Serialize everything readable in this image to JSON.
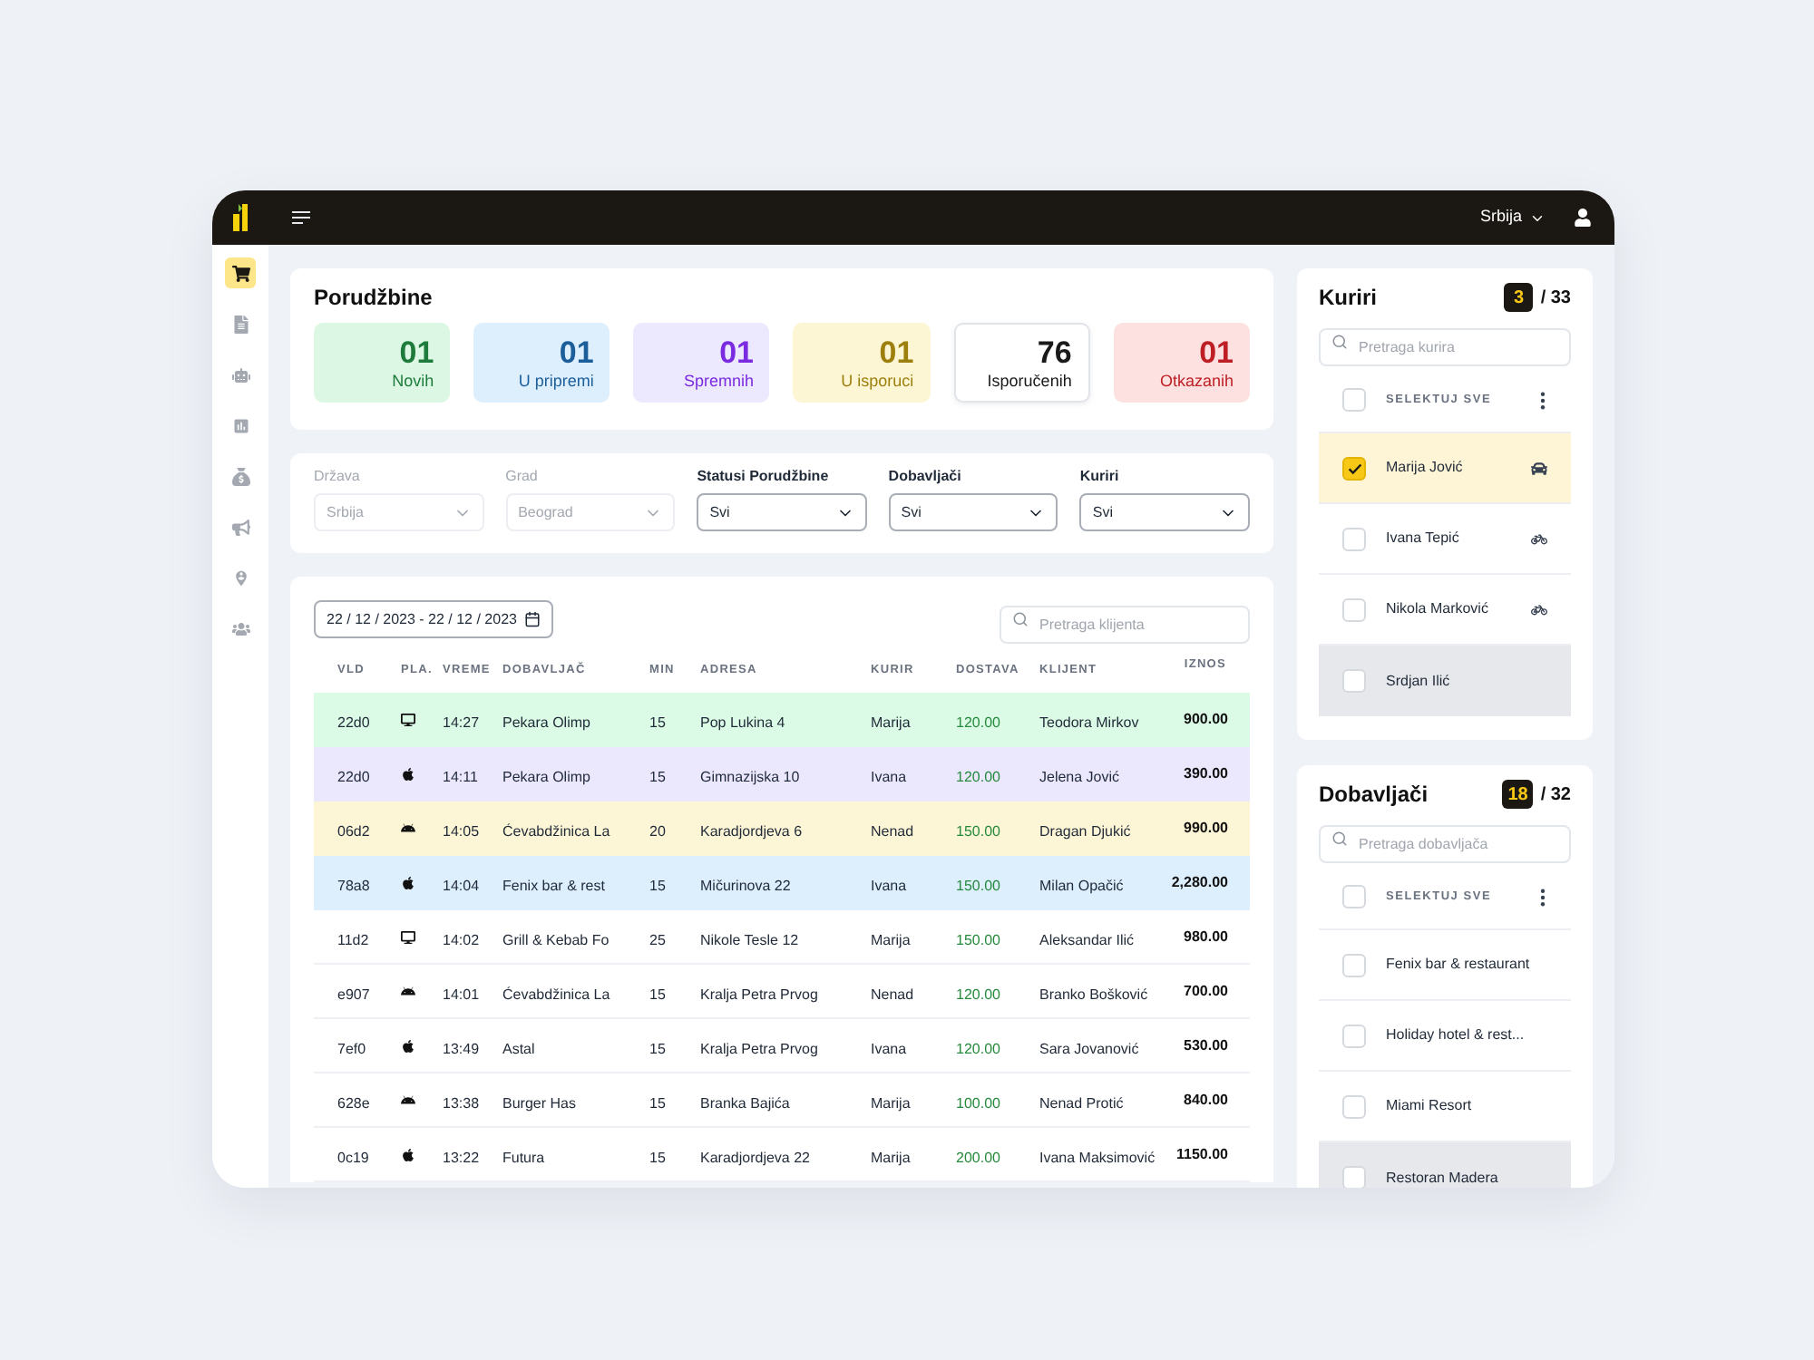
{
  "topbar": {
    "language": "Srbija"
  },
  "sidebar": {
    "items": [
      {
        "kind": "cart",
        "selected": true
      },
      {
        "kind": "document",
        "selected": false
      },
      {
        "kind": "robot",
        "selected": false
      },
      {
        "kind": "chart",
        "selected": false
      },
      {
        "kind": "money",
        "selected": false
      },
      {
        "kind": "megaphone",
        "selected": false
      },
      {
        "kind": "location",
        "selected": false
      },
      {
        "kind": "users",
        "selected": false
      }
    ]
  },
  "orders_summary": {
    "title": "Porudžbine",
    "stats": [
      {
        "kind": "new",
        "value": "01",
        "label": "Novih"
      },
      {
        "kind": "preparing",
        "value": "01",
        "label": "U pripremi"
      },
      {
        "kind": "ready",
        "value": "01",
        "label": "Spremnih"
      },
      {
        "kind": "delivering",
        "value": "01",
        "label": "U isporuci"
      },
      {
        "kind": "delivered",
        "value": "76",
        "label": "Isporučenih"
      },
      {
        "kind": "cancelled",
        "value": "01",
        "label": "Otkazanih"
      }
    ]
  },
  "filters": [
    {
      "label": "Država",
      "value": "Srbija",
      "disabled": true
    },
    {
      "label": "Grad",
      "value": "Beograd",
      "disabled": true
    },
    {
      "label": "Statusi Porudžbine",
      "value": "Svi",
      "disabled": false
    },
    {
      "label": "Dobavljači",
      "value": "Svi",
      "disabled": false
    },
    {
      "label": "Kuriri",
      "value": "Svi",
      "disabled": false
    }
  ],
  "orders_table": {
    "date_range": "22 / 12 / 2023 - 22 / 12 / 2023",
    "search": {
      "placeholder": "Pretraga klijenta"
    },
    "columns": [
      "VLD",
      "PLA.",
      "VREME",
      "DOBAVLJAČ",
      "MIN",
      "ADRESA",
      "KURIR",
      "DOSTAVA",
      "KLIJENT",
      "IZNOS"
    ],
    "rows": [
      {
        "kind": "new",
        "platform": {
          "kind": "desktop"
        },
        "vld": "22d0",
        "time": "14:27",
        "supplier": "Pekara Olimp",
        "min": "15",
        "address": "Pop Lukina 4",
        "courier": "Marija",
        "delivery": "120.00",
        "client": "Teodora Mirkov",
        "amount": "900.00"
      },
      {
        "kind": "ready",
        "platform": {
          "kind": "apple"
        },
        "vld": "22d0",
        "time": "14:11",
        "supplier": "Pekara Olimp",
        "min": "15",
        "address": "Gimnazijska 10",
        "courier": "Ivana",
        "delivery": "120.00",
        "client": "Jelena Jović",
        "amount": "390.00"
      },
      {
        "kind": "delivering",
        "platform": {
          "kind": "android"
        },
        "vld": "06d2",
        "time": "14:05",
        "supplier": "Ćevabdžinica La",
        "min": "20",
        "address": "Karadjordjeva 6",
        "courier": "Nenad",
        "delivery": "150.00",
        "client": "Dragan Djukić",
        "amount": "990.00"
      },
      {
        "kind": "preparing",
        "platform": {
          "kind": "apple"
        },
        "vld": "78a8",
        "time": "14:04",
        "supplier": "Fenix bar & rest",
        "min": "15",
        "address": "Mičurinova 22",
        "courier": "Ivana",
        "delivery": "150.00",
        "client": "Milan Opačić",
        "amount": "2,280.00"
      },
      {
        "kind": "delivered",
        "platform": {
          "kind": "desktop"
        },
        "vld": "11d2",
        "time": "14:02",
        "supplier": "Grill & Kebab Fo",
        "min": "25",
        "address": "Nikole Tesle 12",
        "courier": "Marija",
        "delivery": "150.00",
        "client": "Aleksandar Ilić",
        "amount": "980.00"
      },
      {
        "kind": "delivered",
        "platform": {
          "kind": "android"
        },
        "vld": "e907",
        "time": "14:01",
        "supplier": "Ćevabdžinica La",
        "min": "15",
        "address": "Kralja Petra Prvog",
        "courier": "Nenad",
        "delivery": "120.00",
        "client": "Branko Bošković",
        "amount": "700.00"
      },
      {
        "kind": "delivered",
        "platform": {
          "kind": "apple"
        },
        "vld": "7ef0",
        "time": "13:49",
        "supplier": "Astal",
        "min": "15",
        "address": "Kralja Petra Prvog",
        "courier": "Ivana",
        "delivery": "120.00",
        "client": "Sara Jovanović",
        "amount": "530.00"
      },
      {
        "kind": "delivered",
        "platform": {
          "kind": "android"
        },
        "vld": "628e",
        "time": "13:38",
        "supplier": "Burger Has",
        "min": "15",
        "address": "Branka Bajića",
        "courier": "Marija",
        "delivery": "100.00",
        "client": "Nenad Protić",
        "amount": "840.00"
      },
      {
        "kind": "delivered",
        "platform": {
          "kind": "apple"
        },
        "vld": "0c19",
        "time": "13:22",
        "supplier": "Futura",
        "min": "15",
        "address": "Karadjordjeva 22",
        "courier": "Marija",
        "delivery": "200.00",
        "client": "Ivana Maksimović",
        "amount": "1150.00"
      }
    ]
  },
  "couriers": {
    "title": "Kuriri",
    "selected_count": "3",
    "total": "/ 33",
    "search": {
      "placeholder": "Pretraga kurira"
    },
    "select_all": {
      "label": "SELEKTUJ SVE",
      "checked": false
    },
    "items": [
      {
        "name": "Marija Jović",
        "checked": true,
        "hovered": false,
        "vehicle": {
          "kind": "car"
        }
      },
      {
        "name": "Ivana Tepić",
        "checked": false,
        "hovered": false,
        "vehicle": {
          "kind": "bike"
        }
      },
      {
        "name": "Nikola Marković",
        "checked": false,
        "hovered": false,
        "vehicle": {
          "kind": "bike"
        }
      },
      {
        "name": "Srdjan Ilić",
        "checked": false,
        "hovered": true
      }
    ]
  },
  "suppliers": {
    "title": "Dobavljači",
    "selected_count": "18",
    "total": "/ 32",
    "search": {
      "placeholder": "Pretraga dobavljača"
    },
    "select_all": {
      "label": "SELEKTUJ SVE",
      "checked": false
    },
    "items": [
      {
        "name": "Fenix bar & restaurant",
        "checked": false,
        "hovered": false
      },
      {
        "name": "Holiday hotel & rest...",
        "checked": false,
        "hovered": false
      },
      {
        "name": "Miami Resort",
        "checked": false,
        "hovered": false
      },
      {
        "name": "Restoran Madera",
        "checked": false,
        "hovered": true
      }
    ]
  }
}
